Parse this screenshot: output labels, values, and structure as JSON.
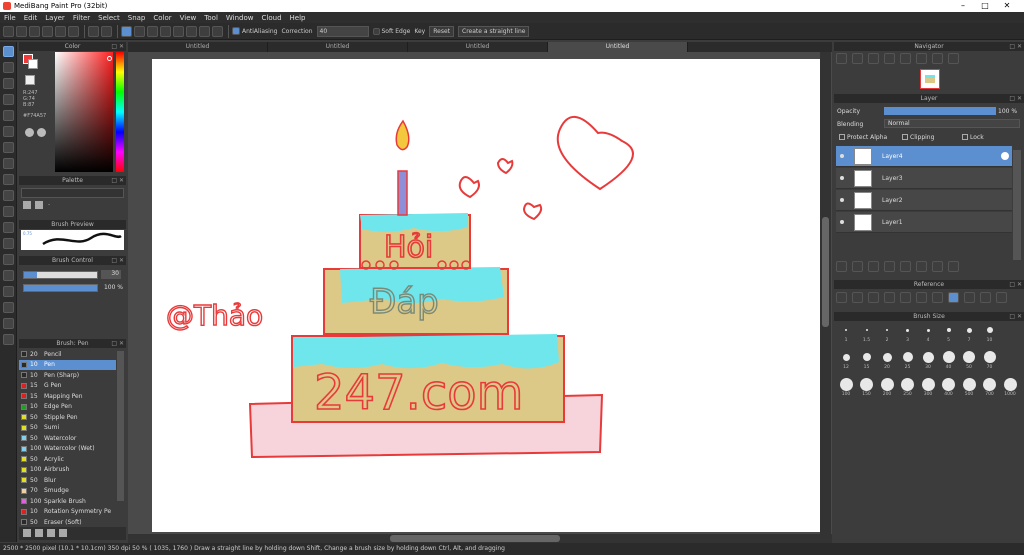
{
  "app": {
    "title": "MediBang Paint Pro (32bit)"
  },
  "menu": [
    "File",
    "Edit",
    "Layer",
    "Filter",
    "Select",
    "Snap",
    "Color",
    "View",
    "Tool",
    "Window",
    "Cloud",
    "Help"
  ],
  "toolbar": {
    "antialias_label": "AntiAliasing",
    "correction_label": "Correction",
    "correction_value": "40",
    "soft_edge_label": "Soft Edge",
    "key_label": "Key",
    "reset_label": "Reset",
    "straight_line_label": "Create a straight line"
  },
  "tabs": [
    "Untitled",
    "Untitled",
    "Untitled",
    "Untitled"
  ],
  "color_panel": {
    "title": "Color",
    "r": "R:247",
    "g": "G:74",
    "b": "B:87",
    "hex": "#F74A57",
    "fg_color": "#f74a57"
  },
  "palette_panel": {
    "title": "Palette",
    "dash": "-"
  },
  "brush_preview": {
    "title": "Brush Preview",
    "size_text": "0.75"
  },
  "brush_control": {
    "title": "Brush Control",
    "size_value": "30",
    "opacity_value": "100 %"
  },
  "brush_list": {
    "title": "Brush: Pen",
    "items": [
      {
        "size": "20",
        "name": "Pencil",
        "color": "#2a2a2a"
      },
      {
        "size": "10",
        "name": "Pen",
        "color": "#2a2a2a"
      },
      {
        "size": "10",
        "name": "Pen (Sharp)",
        "color": "#2a2a2a"
      },
      {
        "size": "15",
        "name": "G Pen",
        "color": "#e02020"
      },
      {
        "size": "15",
        "name": "Mapping Pen",
        "color": "#e02020"
      },
      {
        "size": "10",
        "name": "Edge Pen",
        "color": "#20a020"
      },
      {
        "size": "50",
        "name": "Stipple Pen",
        "color": "#e0e020"
      },
      {
        "size": "50",
        "name": "Sumi",
        "color": "#e0e020"
      },
      {
        "size": "50",
        "name": "Watercolor",
        "color": "#80d0f0"
      },
      {
        "size": "100",
        "name": "Watercolor (Wet)",
        "color": "#80d0f0"
      },
      {
        "size": "50",
        "name": "Acrylic",
        "color": "#e0e020"
      },
      {
        "size": "100",
        "name": "Airbrush",
        "color": "#e0e020"
      },
      {
        "size": "50",
        "name": "Blur",
        "color": "#e0e020"
      },
      {
        "size": "70",
        "name": "Smudge",
        "color": "#f0d0a0"
      },
      {
        "size": "100",
        "name": "Sparkle Brush",
        "color": "#e060e0"
      },
      {
        "size": "10",
        "name": "Rotation Symmetry Pe",
        "color": "#e02020"
      },
      {
        "size": "50",
        "name": "Eraser (Soft)",
        "color": "#2a2a2a"
      }
    ]
  },
  "navigator": {
    "title": "Navigator"
  },
  "layer_panel": {
    "title": "Layer",
    "opacity_label": "Opacity",
    "opacity_value": "100 %",
    "opacity_fraction": 1.0,
    "blending_label": "Blending",
    "blending_value": "Normal",
    "protect_alpha": "Protect Alpha",
    "clipping": "Clipping",
    "lock": "Lock",
    "layers": [
      "Layer4",
      "Layer3",
      "Layer2",
      "Layer1"
    ]
  },
  "reference_panel": {
    "title": "Reference"
  },
  "brush_size_panel": {
    "title": "Brush Size",
    "sizes": [
      "1",
      "1.5",
      "2",
      "3",
      "4",
      "5",
      "7",
      "10",
      "12",
      "15",
      "20",
      "25",
      "30",
      "40",
      "50",
      "70",
      "100",
      "150",
      "200",
      "250",
      "300",
      "400",
      "500",
      "700",
      "1000"
    ]
  },
  "drawing": {
    "handle": "@Thảo",
    "tier1": "Hỏi",
    "tier2": "Đáp",
    "tier3": "247.com"
  },
  "status": {
    "text": "2500 * 2500 pixel   (10.1 * 10.1cm)   350 dpi   50 %   ( 1035, 1760 )   Draw a straight line by holding down Shift, Change a brush size by holding down Ctrl, Alt, and dragging"
  },
  "colors": {
    "accent": "#5b8fd0",
    "cake_frosting": "#6fe6ec",
    "cake_body": "#ddc987",
    "plate": "#f7d3db",
    "ink": "#e83a3a"
  }
}
